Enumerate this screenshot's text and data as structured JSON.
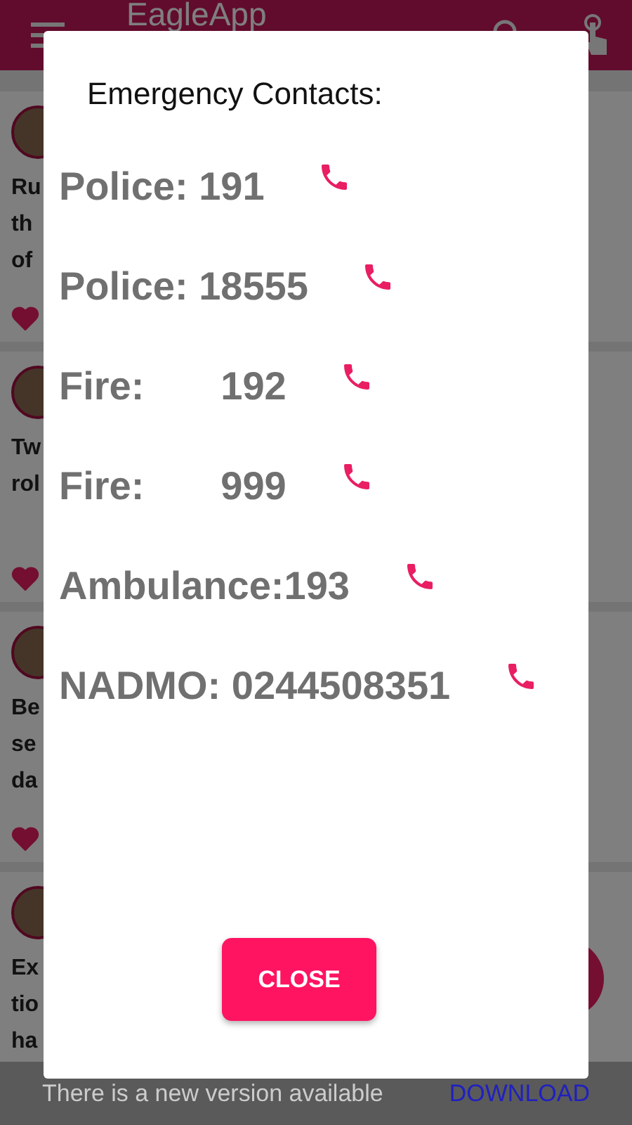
{
  "header": {
    "title": "EagleApp"
  },
  "feed": [
    {
      "lines": [
        "Ru",
        "th",
        "of"
      ],
      "liked": true
    },
    {
      "lines": [
        "Tw",
        "rol"
      ],
      "liked": true
    },
    {
      "lines": [
        "Be",
        "se",
        "da"
      ],
      "liked": true
    },
    {
      "lines": [
        "Ex",
        "tio",
        "ha"
      ]
    }
  ],
  "dialog": {
    "title": "Emergency Contacts:",
    "contacts": [
      {
        "text": "Police: 191"
      },
      {
        "text": "Police: 18555"
      },
      {
        "text": "Fire:       192"
      },
      {
        "text": "Fire:       999"
      },
      {
        "text": "Ambulance:193"
      },
      {
        "text": "NADMO: 0244508351"
      }
    ],
    "button": "CLOSE"
  },
  "snackbar": {
    "message": "There is a new version available",
    "action": "DOWNLOAD"
  }
}
